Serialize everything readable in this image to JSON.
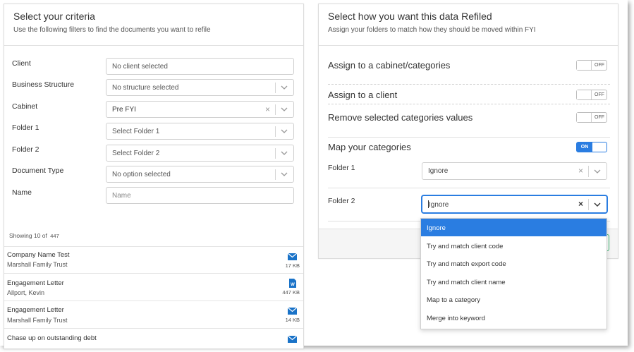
{
  "left_panel": {
    "title": "Select your criteria",
    "subtitle": "Use the following filters to find the documents you want to refile",
    "filters": [
      {
        "label": "Client",
        "value": "No client selected"
      },
      {
        "label": "Business Structure",
        "value": "No structure selected"
      },
      {
        "label": "Cabinet",
        "value": "Pre FYI",
        "clear": "×"
      },
      {
        "label": "Folder 1",
        "value": "Select Folder 1"
      },
      {
        "label": "Folder 2",
        "value": "Select Folder 2"
      },
      {
        "label": "Document Type",
        "value": "No option selected"
      },
      {
        "label": "Name",
        "placeholder": "Name"
      }
    ],
    "showing": "Showing 10 of",
    "total": "447",
    "documents": [
      {
        "title": "Company Name Test",
        "subtitle": "Marshall Family Trust",
        "icon": "email-icon",
        "size": "17 KB"
      },
      {
        "title": "Engagement Letter",
        "subtitle": "Allport, Kevin",
        "icon": "word-doc-icon",
        "size": "447 KB"
      },
      {
        "title": "Engagement Letter",
        "subtitle": "Marshall Family Trust",
        "icon": "email-icon",
        "size": "14 KB"
      },
      {
        "title": "Chase up on outstanding debt",
        "subtitle": "",
        "icon": "email-icon",
        "size": ""
      }
    ]
  },
  "right_panel": {
    "title": "Select how you want this data Refiled",
    "subtitle": "Assign your folders to match how they should be moved within FYI",
    "toggles": [
      {
        "label": "Assign to a cabinet/categories",
        "state": "OFF"
      },
      {
        "label": "Assign to a client",
        "state": "OFF"
      },
      {
        "label": "Remove selected categories values",
        "state": "OFF"
      },
      {
        "label": "Map your categories",
        "state": "ON"
      }
    ],
    "mappings": [
      {
        "label": "Folder 1",
        "value": "Ignore",
        "clear": "×"
      },
      {
        "label": "Folder 2",
        "value": "gnore",
        "caret_prefix": "I",
        "clear": "×"
      }
    ]
  },
  "dropdown": {
    "options": [
      "Ignore",
      "Try and match client code",
      "Try and match export code",
      "Try and match client name",
      "Map to a category",
      "Merge into keyword"
    ],
    "selected": "Ignore"
  },
  "colors": {
    "accent": "#2a7de1",
    "email_icon": "#1a73c8",
    "success": "#3cb371"
  }
}
